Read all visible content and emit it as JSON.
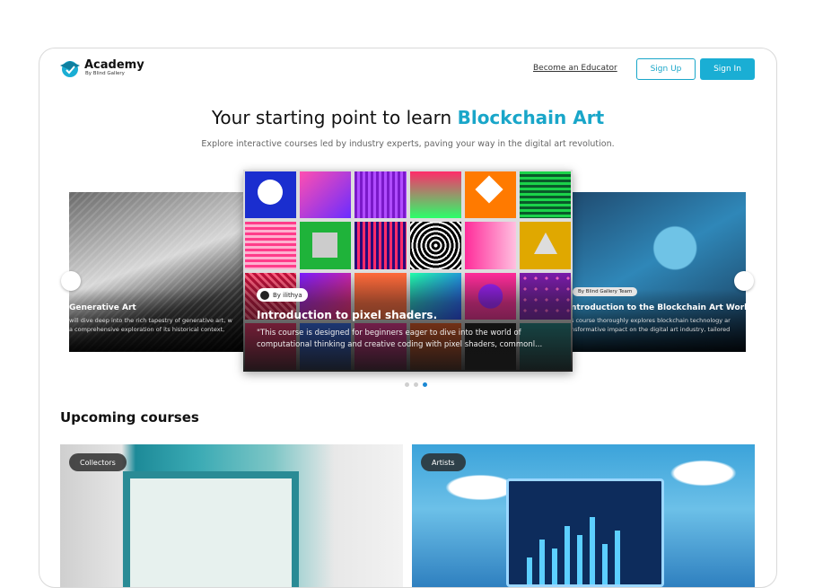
{
  "brand": {
    "title": "Academy",
    "subtitle": "By Blind Gallery",
    "accent_color": "#19a6c9",
    "logo_icon": "graduation-cap-icon"
  },
  "header": {
    "become_educator": "Become an Educator",
    "sign_up": "Sign Up",
    "sign_in": "Sign In"
  },
  "hero": {
    "title_prefix": "Your starting point to learn",
    "title_accent": "Blockchain Art",
    "subtitle": "Explore interactive courses led by industry experts, paving your way in the digital art revolution."
  },
  "carousel": {
    "left_card": {
      "title": "Generative Art",
      "description_line1": "will dive deep into the rich tapestry of generative art, w",
      "description_line2": "a comprehensive exploration of its historical context,"
    },
    "center_card": {
      "author": "By ilithya",
      "title": "Introduction to pixel shaders.",
      "description": "\"This course is designed for beginners eager to dive into the world of computational thinking and creative coding with pixel shaders, commonl..."
    },
    "right_card": {
      "badge": "By Blind Gallery Team",
      "title": "ntroduction to the Blockchain Art World",
      "description_line1": "s course thoroughly explores blockchain technology ar",
      "description_line2": "nsformative impact on the digital art industry, tailored"
    },
    "active_index": 2,
    "dot_count": 3
  },
  "upcoming": {
    "section_title": "Upcoming courses",
    "courses": [
      {
        "tag": "Collectors"
      },
      {
        "tag": "Artists"
      }
    ]
  }
}
